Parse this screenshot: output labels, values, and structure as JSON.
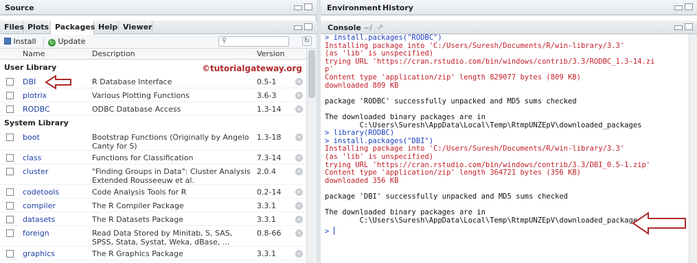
{
  "source_pane": {
    "title": "Source"
  },
  "right_top_tabs": [
    "Environment",
    "History"
  ],
  "files_tabs": [
    "Files",
    "Plots",
    "Packages",
    "Help",
    "Viewer"
  ],
  "toolbar": {
    "install": "Install",
    "update": "Update",
    "search_placeholder": ""
  },
  "columns": {
    "name": "Name",
    "description": "Description",
    "version": "Version"
  },
  "watermark": "©tutorialgateway.org",
  "user_library": {
    "label": "User Library",
    "packages": [
      {
        "name": "DBI",
        "description": "R Database Interface",
        "version": "0.5-1"
      },
      {
        "name": "plotrix",
        "description": "Various Plotting Functions",
        "version": "3.6-3"
      },
      {
        "name": "RODBC",
        "description": "ODBC Database Access",
        "version": "1.3-14"
      }
    ]
  },
  "system_library": {
    "label": "System Library",
    "packages": [
      {
        "name": "boot",
        "description": "Bootstrap Functions (Originally by Angelo Canty for S)",
        "version": "1.3-18"
      },
      {
        "name": "class",
        "description": "Functions for Classification",
        "version": "7.3-14"
      },
      {
        "name": "cluster",
        "description": "\"Finding Groups in Data\": Cluster Analysis Extended Rousseeuw et al.",
        "version": "2.0.4"
      },
      {
        "name": "codetools",
        "description": "Code Analysis Tools for R",
        "version": "0.2-14"
      },
      {
        "name": "compiler",
        "description": "The R Compiler Package",
        "version": "3.3.1"
      },
      {
        "name": "datasets",
        "description": "The R Datasets Package",
        "version": "3.3.1"
      },
      {
        "name": "foreign",
        "description": "Read Data Stored by Minitab, S, SAS, SPSS, Stata, Systat, Weka, dBase, ...",
        "version": "0.8-66"
      },
      {
        "name": "graphics",
        "description": "The R Graphics Package",
        "version": "3.3.1"
      }
    ]
  },
  "console": {
    "title": "Console",
    "path": "~/",
    "lines": [
      {
        "type": "cmd",
        "text": "> install.packages(\"RODBC\")"
      },
      {
        "type": "err",
        "text": "Installing package into 'C:/Users/Suresh/Documents/R/win-library/3.3'"
      },
      {
        "type": "err",
        "text": "(as 'lib' is unspecified)"
      },
      {
        "type": "err",
        "text": "trying URL 'https://cran.rstudio.com/bin/windows/contrib/3.3/RODBC_1.3-14.zi"
      },
      {
        "type": "err",
        "text": "p'"
      },
      {
        "type": "err",
        "text": "Content type 'application/zip' length 829077 bytes (809 KB)"
      },
      {
        "type": "err",
        "text": "downloaded 809 KB"
      },
      {
        "type": "out",
        "text": ""
      },
      {
        "type": "out",
        "text": "package 'RODBC' successfully unpacked and MD5 sums checked"
      },
      {
        "type": "out",
        "text": ""
      },
      {
        "type": "out",
        "text": "The downloaded binary packages are in"
      },
      {
        "type": "out",
        "text": "        C:\\Users\\Suresh\\AppData\\Local\\Temp\\RtmpUNZEpV\\downloaded_packages"
      },
      {
        "type": "cmd",
        "text": "> library(RODBC)"
      },
      {
        "type": "cmd",
        "text": "> install.packages(\"DBI\")"
      },
      {
        "type": "err",
        "text": "Installing package into 'C:/Users/Suresh/Documents/R/win-library/3.3'"
      },
      {
        "type": "err",
        "text": "(as 'lib' is unspecified)"
      },
      {
        "type": "err",
        "text": "trying URL 'https://cran.rstudio.com/bin/windows/contrib/3.3/DBI_0.5-1.zip'"
      },
      {
        "type": "err",
        "text": "Content type 'application/zip' length 364721 bytes (356 KB)"
      },
      {
        "type": "err",
        "text": "downloaded 356 KB"
      },
      {
        "type": "out",
        "text": ""
      },
      {
        "type": "out",
        "text": "package 'DBI' successfully unpacked and MD5 sums checked"
      },
      {
        "type": "out",
        "text": ""
      },
      {
        "type": "out",
        "text": "The downloaded binary packages are in"
      },
      {
        "type": "out",
        "text": "        C:\\Users\\Suresh\\AppData\\Local\\Temp\\RtmpUNZEpV\\downloaded_packages"
      }
    ],
    "prompt": ">"
  },
  "colors": {
    "accent_red": "#b0282a",
    "link_blue": "#1b3fa8",
    "console_cmd": "#1a3ec2",
    "console_err": "#c3202a"
  }
}
